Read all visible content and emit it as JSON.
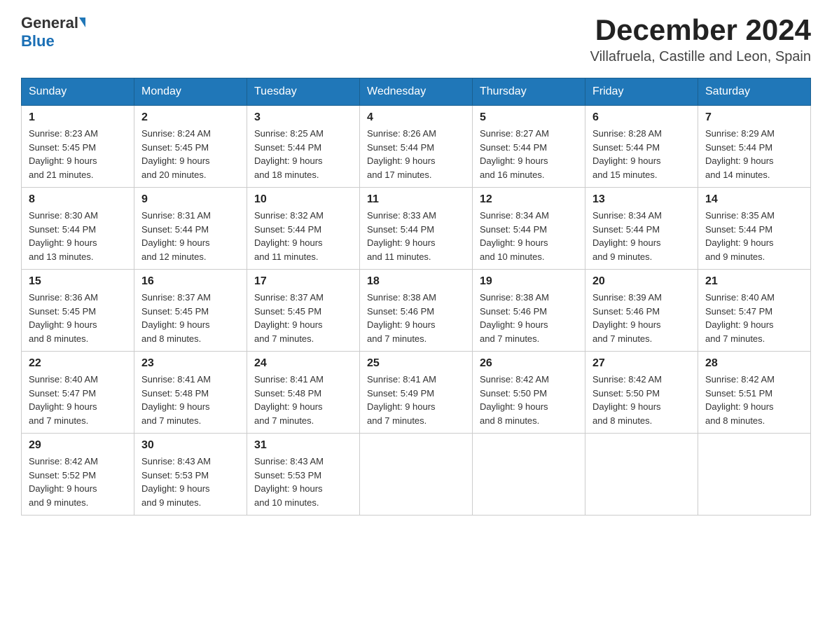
{
  "header": {
    "logo_general": "General",
    "logo_blue": "Blue",
    "month_year": "December 2024",
    "location": "Villafruela, Castille and Leon, Spain"
  },
  "days_of_week": [
    "Sunday",
    "Monday",
    "Tuesday",
    "Wednesday",
    "Thursday",
    "Friday",
    "Saturday"
  ],
  "weeks": [
    [
      {
        "day": "1",
        "sunrise": "8:23 AM",
        "sunset": "5:45 PM",
        "daylight": "9 hours and 21 minutes."
      },
      {
        "day": "2",
        "sunrise": "8:24 AM",
        "sunset": "5:45 PM",
        "daylight": "9 hours and 20 minutes."
      },
      {
        "day": "3",
        "sunrise": "8:25 AM",
        "sunset": "5:44 PM",
        "daylight": "9 hours and 18 minutes."
      },
      {
        "day": "4",
        "sunrise": "8:26 AM",
        "sunset": "5:44 PM",
        "daylight": "9 hours and 17 minutes."
      },
      {
        "day": "5",
        "sunrise": "8:27 AM",
        "sunset": "5:44 PM",
        "daylight": "9 hours and 16 minutes."
      },
      {
        "day": "6",
        "sunrise": "8:28 AM",
        "sunset": "5:44 PM",
        "daylight": "9 hours and 15 minutes."
      },
      {
        "day": "7",
        "sunrise": "8:29 AM",
        "sunset": "5:44 PM",
        "daylight": "9 hours and 14 minutes."
      }
    ],
    [
      {
        "day": "8",
        "sunrise": "8:30 AM",
        "sunset": "5:44 PM",
        "daylight": "9 hours and 13 minutes."
      },
      {
        "day": "9",
        "sunrise": "8:31 AM",
        "sunset": "5:44 PM",
        "daylight": "9 hours and 12 minutes."
      },
      {
        "day": "10",
        "sunrise": "8:32 AM",
        "sunset": "5:44 PM",
        "daylight": "9 hours and 11 minutes."
      },
      {
        "day": "11",
        "sunrise": "8:33 AM",
        "sunset": "5:44 PM",
        "daylight": "9 hours and 11 minutes."
      },
      {
        "day": "12",
        "sunrise": "8:34 AM",
        "sunset": "5:44 PM",
        "daylight": "9 hours and 10 minutes."
      },
      {
        "day": "13",
        "sunrise": "8:34 AM",
        "sunset": "5:44 PM",
        "daylight": "9 hours and 9 minutes."
      },
      {
        "day": "14",
        "sunrise": "8:35 AM",
        "sunset": "5:44 PM",
        "daylight": "9 hours and 9 minutes."
      }
    ],
    [
      {
        "day": "15",
        "sunrise": "8:36 AM",
        "sunset": "5:45 PM",
        "daylight": "9 hours and 8 minutes."
      },
      {
        "day": "16",
        "sunrise": "8:37 AM",
        "sunset": "5:45 PM",
        "daylight": "9 hours and 8 minutes."
      },
      {
        "day": "17",
        "sunrise": "8:37 AM",
        "sunset": "5:45 PM",
        "daylight": "9 hours and 7 minutes."
      },
      {
        "day": "18",
        "sunrise": "8:38 AM",
        "sunset": "5:46 PM",
        "daylight": "9 hours and 7 minutes."
      },
      {
        "day": "19",
        "sunrise": "8:38 AM",
        "sunset": "5:46 PM",
        "daylight": "9 hours and 7 minutes."
      },
      {
        "day": "20",
        "sunrise": "8:39 AM",
        "sunset": "5:46 PM",
        "daylight": "9 hours and 7 minutes."
      },
      {
        "day": "21",
        "sunrise": "8:40 AM",
        "sunset": "5:47 PM",
        "daylight": "9 hours and 7 minutes."
      }
    ],
    [
      {
        "day": "22",
        "sunrise": "8:40 AM",
        "sunset": "5:47 PM",
        "daylight": "9 hours and 7 minutes."
      },
      {
        "day": "23",
        "sunrise": "8:41 AM",
        "sunset": "5:48 PM",
        "daylight": "9 hours and 7 minutes."
      },
      {
        "day": "24",
        "sunrise": "8:41 AM",
        "sunset": "5:48 PM",
        "daylight": "9 hours and 7 minutes."
      },
      {
        "day": "25",
        "sunrise": "8:41 AM",
        "sunset": "5:49 PM",
        "daylight": "9 hours and 7 minutes."
      },
      {
        "day": "26",
        "sunrise": "8:42 AM",
        "sunset": "5:50 PM",
        "daylight": "9 hours and 8 minutes."
      },
      {
        "day": "27",
        "sunrise": "8:42 AM",
        "sunset": "5:50 PM",
        "daylight": "9 hours and 8 minutes."
      },
      {
        "day": "28",
        "sunrise": "8:42 AM",
        "sunset": "5:51 PM",
        "daylight": "9 hours and 8 minutes."
      }
    ],
    [
      {
        "day": "29",
        "sunrise": "8:42 AM",
        "sunset": "5:52 PM",
        "daylight": "9 hours and 9 minutes."
      },
      {
        "day": "30",
        "sunrise": "8:43 AM",
        "sunset": "5:53 PM",
        "daylight": "9 hours and 9 minutes."
      },
      {
        "day": "31",
        "sunrise": "8:43 AM",
        "sunset": "5:53 PM",
        "daylight": "9 hours and 10 minutes."
      },
      null,
      null,
      null,
      null
    ]
  ],
  "labels": {
    "sunrise": "Sunrise:",
    "sunset": "Sunset:",
    "daylight": "Daylight:"
  }
}
